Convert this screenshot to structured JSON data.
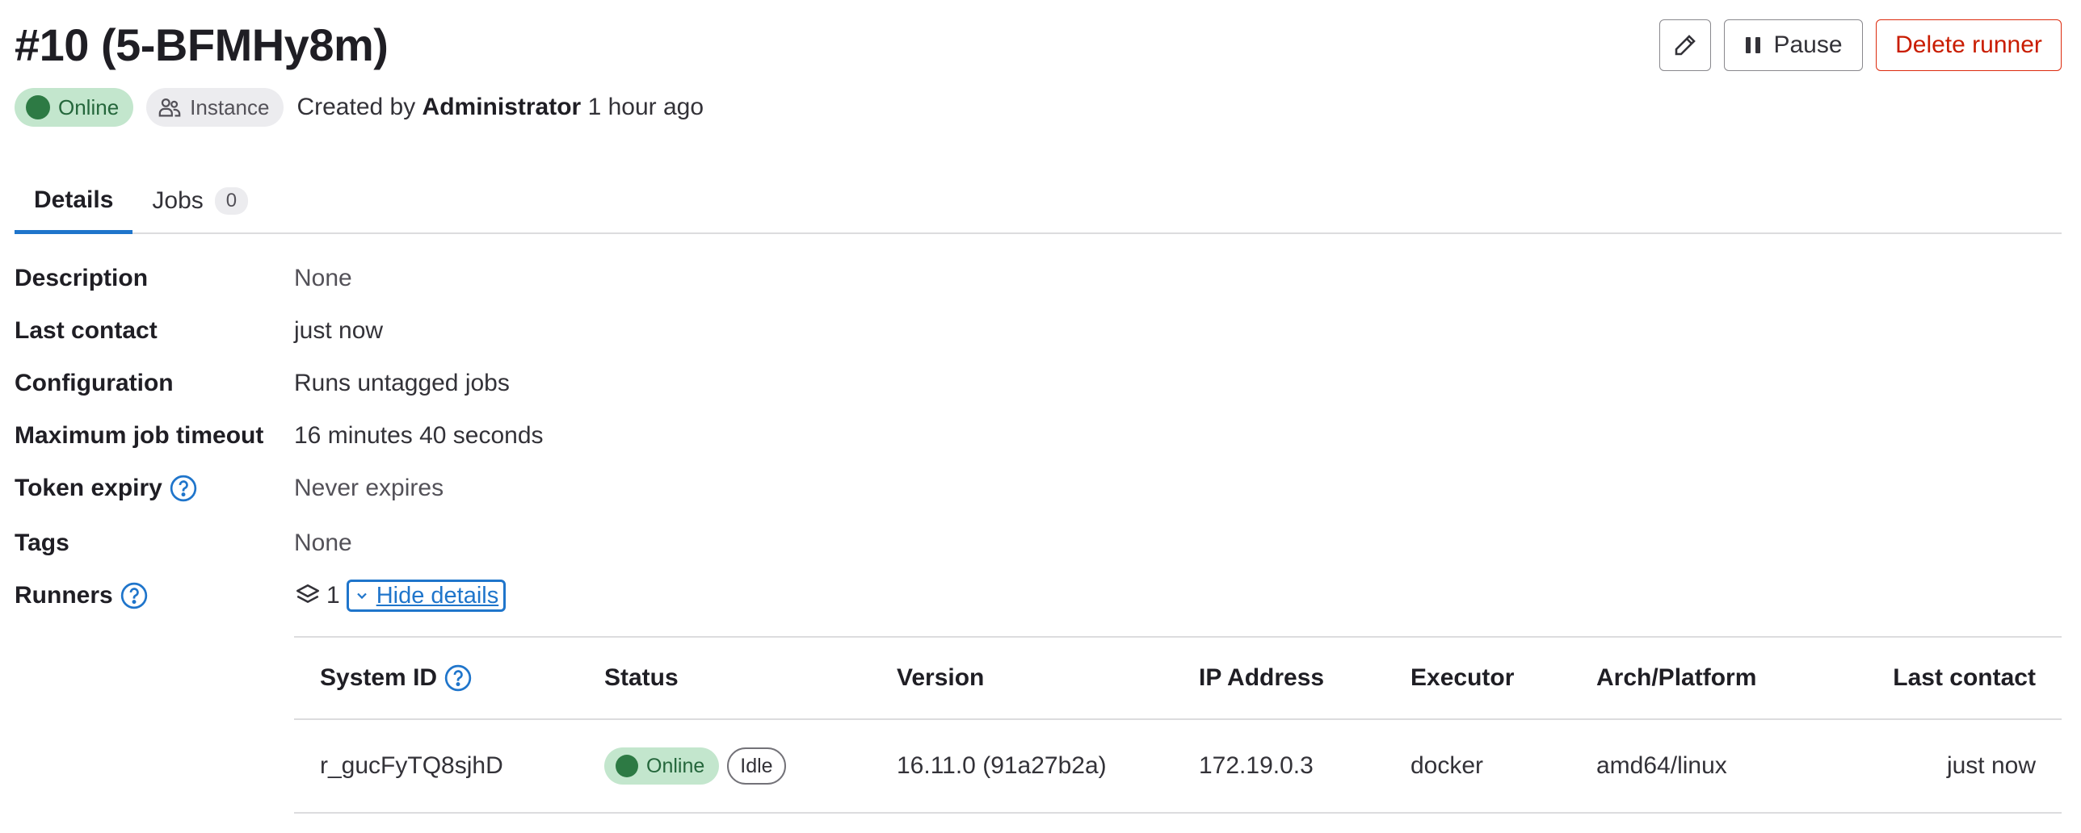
{
  "header": {
    "title": "#10 (5-BFMHy8m)",
    "status_badge": "Online",
    "type_badge": "Instance",
    "created_prefix": "Created by",
    "created_by": "Administrator",
    "created_when": "1 hour ago",
    "actions": {
      "edit_icon": "pencil-icon",
      "pause_label": "Pause",
      "delete_label": "Delete runner"
    }
  },
  "tabs": [
    {
      "label": "Details",
      "active": true
    },
    {
      "label": "Jobs",
      "count": "0"
    }
  ],
  "details": {
    "description": {
      "label": "Description",
      "value": "None"
    },
    "last_contact": {
      "label": "Last contact",
      "value": "just now"
    },
    "configuration": {
      "label": "Configuration",
      "value": "Runs untagged jobs"
    },
    "max_timeout": {
      "label": "Maximum job timeout",
      "value": "16 minutes 40 seconds"
    },
    "token_expiry": {
      "label": "Token expiry",
      "value": "Never expires"
    },
    "tags": {
      "label": "Tags",
      "value": "None"
    },
    "runners": {
      "label": "Runners",
      "count": "1",
      "toggle_label": "Hide details"
    }
  },
  "runner_table": {
    "columns": [
      "System ID",
      "Status",
      "Version",
      "IP Address",
      "Executor",
      "Arch/Platform",
      "Last contact"
    ],
    "rows": [
      {
        "system_id": "r_gucFyTQ8sjhD",
        "status": "Online",
        "state": "Idle",
        "version": "16.11.0 (91a27b2a)",
        "ip": "172.19.0.3",
        "executor": "docker",
        "platform": "amd64/linux",
        "last_contact": "just now"
      }
    ]
  },
  "colors": {
    "accent": "#1f75cb",
    "online_bg": "#c3e6cd",
    "online_dot": "#2d7a44",
    "danger": "#dd2b0e"
  }
}
